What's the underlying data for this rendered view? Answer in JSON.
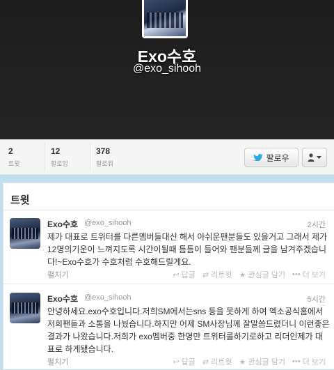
{
  "profile": {
    "display_name": "Exo수호",
    "screen_name": "@exo_sihooh"
  },
  "stats": [
    {
      "value": "2",
      "label": "트윗"
    },
    {
      "value": "12",
      "label": "팔로잉"
    },
    {
      "value": "378",
      "label": "팔로워"
    }
  ],
  "actions": {
    "follow_label": "팔로우",
    "user_icon": "person-icon"
  },
  "tweets_panel": {
    "title": "트윗"
  },
  "tweets": [
    {
      "name": "Exo수호",
      "handle": "@exo_sihooh",
      "time": "2시간",
      "text": "제가 대표로 트위터를 다른멤버들대신 해서 아쉬운팬분들도 있을거고 그래서 제가 12명의기운이 느껴지도록 시간이될때 틈틈이 들어와 팬분들께 글을 남겨주겠습니다!~Exo수호가 수호처럼 수호해드릴게요.",
      "expand": "펼치기",
      "reply": "답글",
      "retweet": "리트윗",
      "favorite": "관심글 담기",
      "more": "더 보기"
    },
    {
      "name": "Exo수호",
      "handle": "@exo_sihooh",
      "time": "5시간",
      "text": "안녕하세요.exo수호입니다.저희SM에서는sns 등을 못하게 하여 엑소공식홈에서 저희팬들과 소통을 나눴습니다.하지만 어제 SM사장님께 잘말씀드렸더니 이런좋은 결과가 나왔습니다.저희가 exo멤버중 한명만 트위터를하기로하고 리더인제가 대표로 하게됐습니다.",
      "expand": "펼치기",
      "reply": "답글",
      "retweet": "리트윗",
      "favorite": "관심글 담기",
      "more": "더 보기"
    }
  ],
  "colors": {
    "background": "#c0deed",
    "header": "#1f1f1f",
    "follow_bird": "#2fa8e1"
  }
}
